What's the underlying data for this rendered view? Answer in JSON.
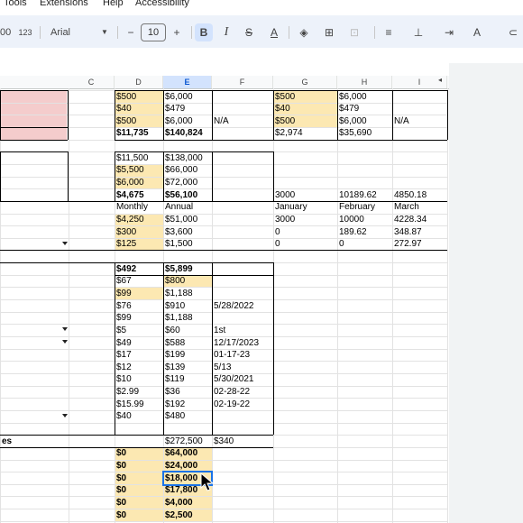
{
  "menu": [
    "Tools",
    "Extensions",
    "Help",
    "Accessibility"
  ],
  "toolbar": {
    "format_123": "123",
    "font": "Arial",
    "font_size": "10",
    "zoom_partial": "00"
  },
  "column_headers": [
    "C",
    "D",
    "E",
    "F",
    "G",
    "H",
    "I"
  ],
  "selected_column": "E",
  "rows": [
    {
      "d": "$500",
      "e": "$6,000",
      "f": "",
      "g": "$500",
      "h": "$6,000",
      "i": ""
    },
    {
      "d": "$40",
      "e": "$479",
      "f": "",
      "g": "$40",
      "h": "$479",
      "i": ""
    },
    {
      "d": "$500",
      "e": "$6,000",
      "f": "N/A",
      "g": "$500",
      "h": "$6,000",
      "i": "N/A"
    },
    {
      "d": "$11,735",
      "e": "$140,824",
      "f": "",
      "g": "$2,974",
      "h": "$35,690",
      "i": ""
    },
    {
      "d": "",
      "e": "",
      "f": "",
      "g": "",
      "h": "",
      "i": ""
    },
    {
      "d": "$11,500",
      "e": "$138,000",
      "f": "",
      "g": "",
      "h": "",
      "i": ""
    },
    {
      "d": "$5,500",
      "e": "$66,000",
      "f": "",
      "g": "",
      "h": "",
      "i": ""
    },
    {
      "d": "$6,000",
      "e": "$72,000",
      "f": "",
      "g": "",
      "h": "",
      "i": ""
    },
    {
      "d": "$4,675",
      "e": "$56,100",
      "f": "",
      "g": "3000",
      "h": "10189.62",
      "i": "4850.18"
    },
    {
      "d": "Monthly",
      "e": "Annual",
      "f": "",
      "g": "January",
      "h": "February",
      "i": "March"
    },
    {
      "d": "$4,250",
      "e": "$51,000",
      "f": "",
      "g": "3000",
      "h": "10000",
      "i": "4228.34"
    },
    {
      "d": "$300",
      "e": "$3,600",
      "f": "",
      "g": "0",
      "h": "189.62",
      "i": "348.87"
    },
    {
      "d": "$125",
      "e": "$1,500",
      "f": "",
      "g": "0",
      "h": "0",
      "i": "272.97"
    },
    {
      "d": "",
      "e": "",
      "f": "",
      "g": "",
      "h": "",
      "i": ""
    },
    {
      "d": "$492",
      "e": "$5,899",
      "f": "",
      "g": "",
      "h": "",
      "i": ""
    },
    {
      "d": "$67",
      "e": "$800",
      "f": "",
      "g": "",
      "h": "",
      "i": ""
    },
    {
      "d": "$99",
      "e": "$1,188",
      "f": "",
      "g": "",
      "h": "",
      "i": ""
    },
    {
      "d": "$76",
      "e": "$910",
      "f": "5/28/2022",
      "g": "",
      "h": "",
      "i": ""
    },
    {
      "d": "$99",
      "e": "$1,188",
      "f": "",
      "g": "",
      "h": "",
      "i": ""
    },
    {
      "d": "$5",
      "e": "$60",
      "f": "1st",
      "g": "",
      "h": "",
      "i": ""
    },
    {
      "d": "$49",
      "e": "$588",
      "f": "12/17/2023",
      "g": "",
      "h": "",
      "i": ""
    },
    {
      "d": "$17",
      "e": "$199",
      "f": "01-17-23",
      "g": "",
      "h": "",
      "i": ""
    },
    {
      "d": "$12",
      "e": "$139",
      "f": "5/13",
      "g": "",
      "h": "",
      "i": ""
    },
    {
      "d": "$10",
      "e": "$119",
      "f": "5/30/2021",
      "g": "",
      "h": "",
      "i": ""
    },
    {
      "d": "$2.99",
      "e": "$36",
      "f": "02-28-22",
      "g": "",
      "h": "",
      "i": ""
    },
    {
      "d": "$15.99",
      "e": "$192",
      "f": "02-19-22",
      "g": "",
      "h": "",
      "i": ""
    },
    {
      "d": "$40",
      "e": "$480",
      "f": "",
      "g": "",
      "h": "",
      "i": ""
    },
    {
      "d": "",
      "e": "",
      "f": "",
      "g": "",
      "h": "",
      "i": ""
    },
    {
      "d": "",
      "e": "$272,500",
      "f": "$340",
      "g": "",
      "h": "",
      "i": ""
    },
    {
      "d": "$0",
      "e": "$64,000",
      "f": "",
      "g": "",
      "h": "",
      "i": ""
    },
    {
      "d": "$0",
      "e": "$24,000",
      "f": "",
      "g": "",
      "h": "",
      "i": ""
    },
    {
      "d": "$0",
      "e": "$18,000",
      "f": "",
      "g": "",
      "h": "",
      "i": ""
    },
    {
      "d": "$0",
      "e": "$17,800",
      "f": "",
      "g": "",
      "h": "",
      "i": ""
    },
    {
      "d": "$0",
      "e": "$4,000",
      "f": "",
      "g": "",
      "h": "",
      "i": ""
    },
    {
      "d": "$0",
      "e": "$2,500",
      "f": "",
      "g": "",
      "h": "",
      "i": ""
    }
  ],
  "row_label_partial": "es",
  "colors": {
    "orange_fill": "#fce8b2",
    "pink_fill": "#f4cccc",
    "selection": "#1a73e8",
    "toolbar_bg": "#edf2fa"
  }
}
